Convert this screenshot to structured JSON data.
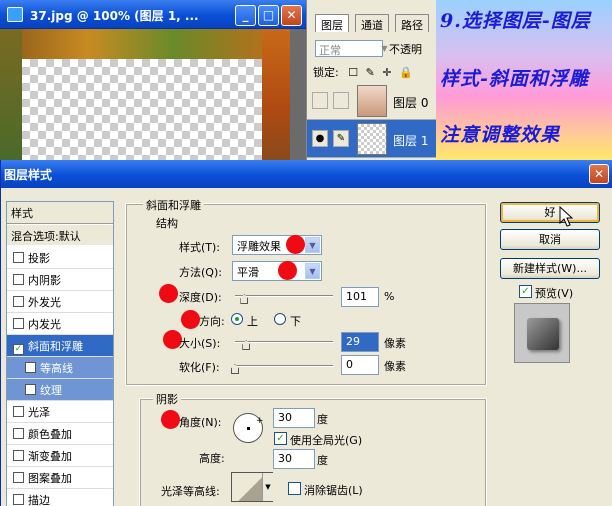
{
  "document_window": {
    "title": "37.jpg @ 100% (图层 1, ...",
    "min_glyph": "_",
    "max_glyph": "□",
    "close_glyph": "✕"
  },
  "layers_panel": {
    "tabs": [
      "图层",
      "通道",
      "路径"
    ],
    "blend_mode": "正常",
    "opacity_label": "不透明",
    "lock_label": "锁定:",
    "lock_icons": [
      "lock-transparency-icon",
      "lock-brush-icon",
      "lock-move-icon",
      "lock-all-icon"
    ],
    "lock_glyphs": [
      "☐",
      "✎",
      "✛",
      "🔒"
    ],
    "layers": [
      {
        "name": "图层 0",
        "visible": false,
        "selected": false
      },
      {
        "name": "图层 1",
        "visible": true,
        "selected": true
      }
    ]
  },
  "instruction_banner": {
    "lines": [
      "9.选择图层-图层",
      "样式-斜面和浮雕",
      "注意调整效果"
    ],
    "colors": {
      "text": "#1b1bd8"
    }
  },
  "dialog": {
    "title": "图层样式",
    "close_glyph": "✕",
    "style_list": {
      "header": "样式",
      "blend_options": "混合选项:默认",
      "items": [
        {
          "label": "投影",
          "checked": false,
          "selected": false,
          "sub": false
        },
        {
          "label": "内阴影",
          "checked": false,
          "selected": false,
          "sub": false
        },
        {
          "label": "外发光",
          "checked": false,
          "selected": false,
          "sub": false
        },
        {
          "label": "内发光",
          "checked": false,
          "selected": false,
          "sub": false
        },
        {
          "label": "斜面和浮雕",
          "checked": true,
          "selected": true,
          "sub": false
        },
        {
          "label": "等高线",
          "checked": false,
          "selected": false,
          "sub": true
        },
        {
          "label": "纹理",
          "checked": false,
          "selected": false,
          "sub": true
        },
        {
          "label": "光泽",
          "checked": false,
          "selected": false,
          "sub": false
        },
        {
          "label": "颜色叠加",
          "checked": false,
          "selected": false,
          "sub": false
        },
        {
          "label": "渐变叠加",
          "checked": false,
          "selected": false,
          "sub": false
        },
        {
          "label": "图案叠加",
          "checked": false,
          "selected": false,
          "sub": false
        },
        {
          "label": "描边",
          "checked": false,
          "selected": false,
          "sub": false
        }
      ]
    },
    "bevel": {
      "group_title": "斜面和浮雕",
      "structure_title": "结构",
      "style_label": "样式(T):",
      "style_value": "浮雕效果",
      "technique_label": "方法(Q):",
      "technique_value": "平滑",
      "depth_label": "深度(D):",
      "depth_value": "101",
      "depth_unit": "%",
      "depth_fraction": 0.1,
      "direction_label": "方向:",
      "direction_up": "上",
      "direction_down": "下",
      "direction_selected": "上",
      "size_label": "大小(S):",
      "size_value": "29",
      "size_unit": "像素",
      "size_fraction": 0.12,
      "soften_label": "软化(F):",
      "soften_value": "0",
      "soften_unit": "像素",
      "soften_fraction": 0
    },
    "shading": {
      "group_title": "阴影",
      "angle_label": "角度(N):",
      "angle_value": "30",
      "angle_unit": "度",
      "global_light_label": "使用全局光(G)",
      "global_light_checked": true,
      "altitude_label": "高度:",
      "altitude_value": "30",
      "altitude_unit": "度",
      "gloss_label": "光泽等高线:",
      "antialias_label": "消除锯齿(L)",
      "antialias_checked": false
    },
    "buttons": {
      "ok": "好",
      "cancel": "取消",
      "new_style": "新建样式(W)...",
      "preview_label": "预览(V)",
      "preview_checked": true
    },
    "colors": {
      "annotation_dot": "#f00a14",
      "selection": "#316ac5",
      "titlebar": "#0a4fd6"
    }
  }
}
